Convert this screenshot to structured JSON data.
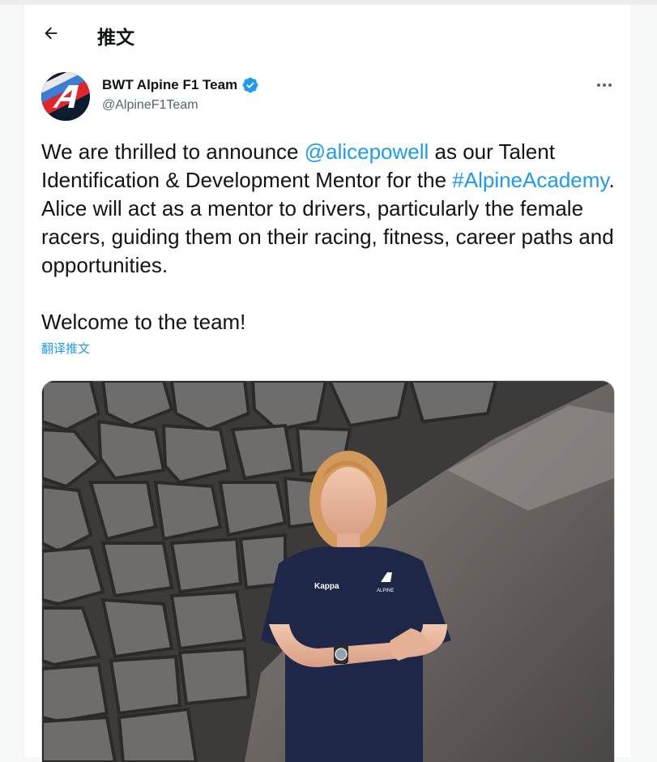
{
  "header": {
    "title": "推文",
    "back_icon": "arrow-left-icon"
  },
  "tweet": {
    "author": {
      "display_name": "BWT Alpine F1 Team",
      "handle": "@AlpineF1Team",
      "verified_icon": "verified-badge-icon",
      "avatar": "alpine-logo-avatar"
    },
    "more_icon": "more-horizontal-icon",
    "text": {
      "p1_a": "We are thrilled to announce ",
      "mention": "@alicepowell",
      "p1_b": " as our Talent Identification & Development Mentor for the ",
      "hashtag": "#AlpineAcademy",
      "p1_c": ". Alice will act as a mentor to drivers, particularly the female racers, guiding them on their racing, fitness, career paths and opportunities.",
      "p2": "Welcome to the team!"
    },
    "translate_label": "翻译推文",
    "media": {
      "shirt_brand_left": "Kappa",
      "shirt_brand_right": "ALPINE"
    }
  },
  "colors": {
    "accent": "#1d9bf0",
    "text": "#0f1419",
    "secondary": "#536471"
  }
}
